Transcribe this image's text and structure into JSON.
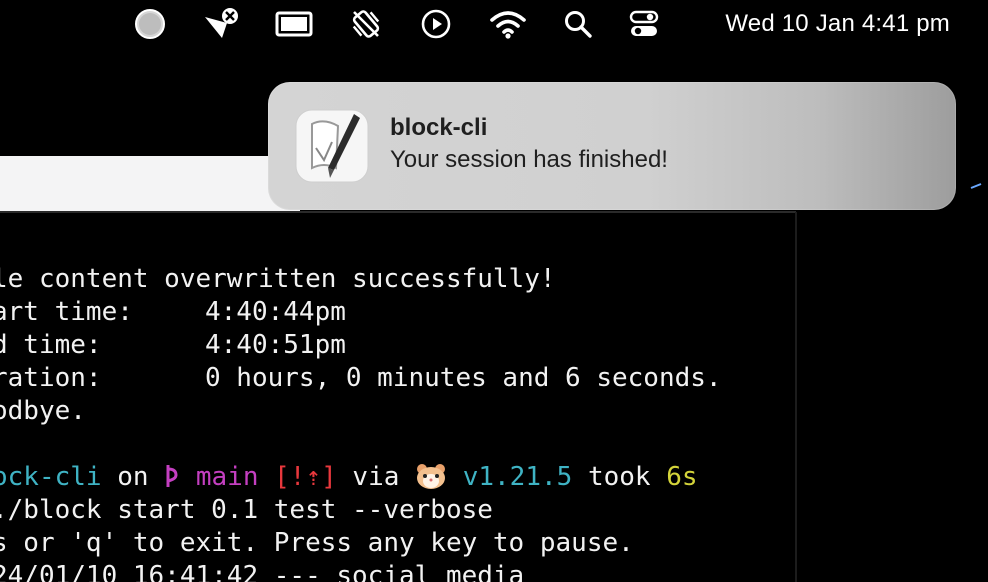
{
  "menubar": {
    "icons": [
      "user-circle-icon",
      "vpn-disconnected-icon",
      "display-icon",
      "do-not-disturb-icon",
      "play-icon",
      "wifi-icon",
      "search-icon",
      "control-center-icon"
    ],
    "datetime": "Wed 10 Jan  4:41 pm"
  },
  "notification": {
    "app_icon": "script-editor-icon",
    "title": "block-cli",
    "body": "Your session has finished!"
  },
  "terminal": {
    "line1": "le content overwritten successfully!",
    "line2_label": "art time:",
    "line2_value": "4:40:44pm",
    "line3_label": "d time:",
    "line3_value": "4:40:51pm",
    "line4_label": "ration:",
    "line4_value": "0 hours, 0 minutes and 6 seconds.",
    "line5": "odbye.",
    "prompt": {
      "dir": "ock-cli",
      "on": "on",
      "branch_icon": "git-branch-icon",
      "branch": "main",
      "status": "[!⇡]",
      "via": "via",
      "runtime_icon": "hamster-icon",
      "version": "v1.21.5",
      "took": "took",
      "duration": "6s"
    },
    "line7": "./block start 0.1 test --verbose",
    "line8": "s or 'q' to exit. Press any key to pause.",
    "line9": "24/01/10 16:41:42 --- social media"
  },
  "colors": {
    "cyan": "#3fb3c4",
    "magenta": "#c43fc1",
    "red": "#e8383d",
    "yellow": "#d4d43a"
  }
}
